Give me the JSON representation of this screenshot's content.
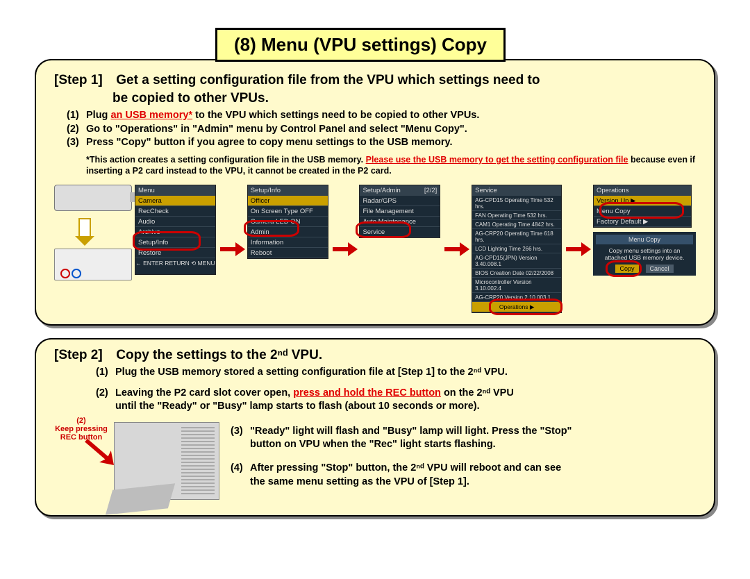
{
  "title": "(8) Menu (VPU settings) Copy",
  "step1": {
    "label": "[Step 1]",
    "heading_a": "Get a setting configuration file from the VPU which settings need to",
    "heading_b": "be copied to other VPUs.",
    "items": [
      {
        "n": "(1)",
        "pre": "Plug ",
        "red": "an USB memory*",
        "post": " to the VPU which settings need to be copied to other VPUs."
      },
      {
        "n": "(2)",
        "text": "Go to \"Operations\" in \"Admin\" menu by Control Panel and select \"Menu Copy\"."
      },
      {
        "n": "(3)",
        "text": "Press \"Copy\" button if you agree to copy menu settings to the USB memory."
      }
    ],
    "note_a": "*This action creates a setting configuration file in the USB memory.  ",
    "note_red": "Please use the USB memory to get the setting configuration file",
    "note_b": " because even if inserting a P2 card instead to the  VPU, it cannot be created in the P2 card."
  },
  "menus": {
    "m1": {
      "title": "Menu",
      "items": [
        "Camera",
        "RecCheck",
        "Audio",
        "Archive",
        "Setup/Info",
        "Restore"
      ],
      "footer": "← ENTER       RETURN ⟲     MENU"
    },
    "m2": {
      "title": "Setup/Info",
      "items": [
        "Officer",
        "On Screen Type        OFF",
        "Camera LED           ON",
        "Admin",
        "Information",
        "Reboot"
      ]
    },
    "m3": {
      "title": "Setup/Admin",
      "page": "[2/2]",
      "items": [
        "Radar/GPS",
        "File Management",
        "Auto Maintenance",
        "Service"
      ]
    },
    "m4": {
      "title": "Service",
      "items": [
        "AG-CPD15 Operating Time       532 hrs.",
        "FAN       Operating Time       532 hrs.",
        "CAM1    Operating Time     4842 hrs.",
        "AG-CRP20 Operating Time       618 hrs.",
        "LCD       Lighting Time         266 hrs.",
        "AG-CPD15(JPN)   Version  3.40.008.1",
        "BIOS       Creation Date  02/22/2008",
        "Microcontroller  Version  3.10.002.4",
        "AG-CRP20            Version  2.10.003.1",
        "Operations              ▶"
      ]
    },
    "m5": {
      "title": "Operations",
      "items": [
        "Version Up         ▶",
        "Menu Copy",
        "Factory Default    ▶"
      ]
    },
    "dlg": {
      "title": "Menu Copy",
      "msg1": "Copy menu settings into an",
      "msg2": "attached USB memory device.",
      "ok": "Copy",
      "cancel": "Cancel"
    }
  },
  "step2": {
    "label": "[Step 2]",
    "heading": "Copy the settings to the 2ⁿᵈ VPU.",
    "rec_note_n": "(2)",
    "rec_note": "Keep pressing REC button",
    "items": [
      {
        "n": "(1)",
        "text": "Plug the USB memory stored a setting configuration file at [Step 1] to the 2ⁿᵈ  VPU."
      },
      {
        "n": "(2)",
        "pre": "Leaving the P2 card slot cover open, ",
        "red": "press and hold the REC button",
        "post": " on the 2ⁿᵈ VPU",
        "cont": "until the \"Ready\" or \"Busy\" lamp starts to flash (about 10 seconds or more)."
      },
      {
        "n": "(3)",
        "text": "\"Ready\" light will flash and \"Busy\" lamp will light.  Press the  \"Stop\"",
        "cont": "button on VPU when the \"Rec\" light starts flashing."
      },
      {
        "n": "(4)",
        "text": "After pressing \"Stop\" button, the 2ⁿᵈ VPU will reboot and can see",
        "cont": "the same menu setting as the VPU of [Step 1]."
      }
    ]
  }
}
